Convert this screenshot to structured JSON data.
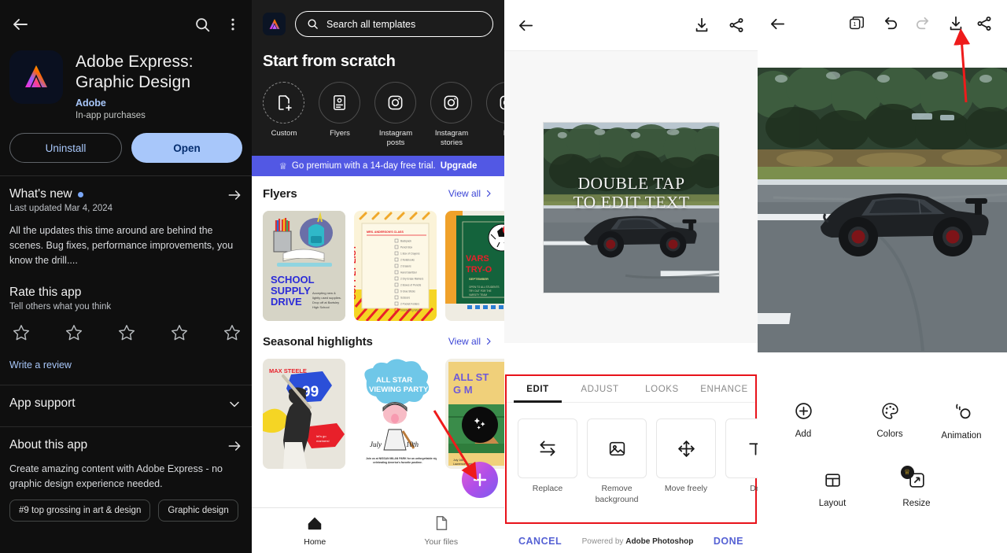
{
  "panel1": {
    "name": "google-play-store-app-page",
    "topbar": {
      "back_icon": "back-arrow-icon",
      "search_icon": "search-icon",
      "more_icon": "overflow-menu-icon"
    },
    "app": {
      "title": "Adobe Express: Graphic Design",
      "developer": "Adobe",
      "iap": "In-app purchases",
      "icon": "adobe-express-logo-icon"
    },
    "buttons": {
      "uninstall": "Uninstall",
      "open": "Open"
    },
    "whats_new": {
      "heading": "What's new",
      "subtitle": "Last updated Mar 4, 2024",
      "body": "All the updates this time around are behind the scenes. Bug fixes, performance improvements, you know the drill....",
      "arrow_icon": "arrow-right-icon"
    },
    "rate": {
      "heading": "Rate this app",
      "subtitle": "Tell others what you think",
      "stars": 5,
      "write_review": "Write a review"
    },
    "app_support": {
      "label": "App support",
      "chevron_icon": "chevron-down-icon"
    },
    "about": {
      "label": "About this app",
      "arrow_icon": "arrow-right-icon",
      "body": "Create amazing content with Adobe Express - no graphic design experience needed."
    },
    "chips": [
      "#9 top grossing in art & design",
      "Graphic design"
    ]
  },
  "panel2": {
    "name": "adobe-express-home",
    "logo_icon": "adobe-express-logo-icon",
    "search": {
      "placeholder": "Search all templates",
      "icon": "search-icon"
    },
    "scratch_heading": "Start from scratch",
    "scratch_items": [
      {
        "label": "Custom",
        "icon": "document-plus-icon"
      },
      {
        "label": "Flyers",
        "icon": "flyer-icon"
      },
      {
        "label": "Instagram posts",
        "icon": "instagram-icon"
      },
      {
        "label": "Instagram stories",
        "icon": "instagram-icon"
      },
      {
        "label": "Lo",
        "icon": "instagram-icon"
      }
    ],
    "premium_banner": {
      "crown_icon": "crown-icon",
      "text": "Go premium with a 14-day free trial.",
      "cta": "Upgrade"
    },
    "rows": [
      {
        "title": "Flyers",
        "view_all": "View all",
        "cards": [
          {
            "name": "school-supply-drive-flyer",
            "title": "SCHOOL SUPPLY DRIVE",
            "caption": "Accepting new & lightly used supplies. Drop off at Bartsley High School"
          },
          {
            "name": "first-grade-supply-list-flyer",
            "title": "FIRST GRADE SUPPLY LIST",
            "caption": "MRS. ANDERSON'S CLASS"
          },
          {
            "name": "varsity-tryouts-flyer",
            "title": "VARSITY TRY-OUTS",
            "caption": "SEPTEMBER"
          }
        ]
      },
      {
        "title": "Seasonal highlights",
        "view_all": "View all",
        "cards": [
          {
            "name": "max-steele-baseball-card",
            "title": "MAX STEELE",
            "caption": "99"
          },
          {
            "name": "all-star-viewing-party-flyer",
            "title": "ALL STAR VIEWING PARTY",
            "caption": "July 10th"
          },
          {
            "name": "all-star-game-flyer",
            "title": "ALL ST",
            "caption": ""
          }
        ]
      }
    ],
    "bottom_nav": [
      {
        "label": "Home",
        "icon": "home-icon",
        "active": true
      },
      {
        "label": "Your files",
        "icon": "files-icon",
        "active": false
      }
    ],
    "fab_black_icon": "sparkle-icon",
    "fab_plus_icon": "plus-icon"
  },
  "panel3": {
    "name": "photoshop-express-editor",
    "topbar": {
      "back_icon": "back-arrow-icon",
      "download_icon": "download-icon",
      "share_icon": "share-icon"
    },
    "canvas": {
      "overlay_text_line1": "DOUBLE TAP",
      "overlay_text_line2": "TO EDIT TEXT",
      "photo": "black-sports-car-on-highway"
    },
    "tabs": [
      {
        "label": "EDIT",
        "active": true
      },
      {
        "label": "ADJUST",
        "active": false
      },
      {
        "label": "LOOKS",
        "active": false
      },
      {
        "label": "ENHANCE",
        "active": false
      }
    ],
    "tools": [
      {
        "label": "Replace",
        "icon": "swap-arrows-icon"
      },
      {
        "label": "Remove background",
        "icon": "image-icon"
      },
      {
        "label": "Move freely",
        "icon": "move-icon"
      },
      {
        "label": "De",
        "icon": "text-icon"
      }
    ],
    "footer": {
      "cancel": "CANCEL",
      "powered_prefix": "Powered by ",
      "powered_brand": "Adobe Photoshop",
      "done": "DONE"
    }
  },
  "panel4": {
    "name": "adobe-express-project-editor",
    "topbar": {
      "back_icon": "back-arrow-icon",
      "pages_icon": "pages-stack-icon",
      "undo_icon": "undo-icon",
      "redo_icon": "redo-icon",
      "download_icon": "download-icon",
      "share_icon": "share-icon"
    },
    "canvas": {
      "photo": "black-sports-car-on-highway"
    },
    "grid": [
      {
        "label": "Add",
        "icon": "plus-circle-icon",
        "premium": false
      },
      {
        "label": "Colors",
        "icon": "palette-icon",
        "premium": false
      },
      {
        "label": "Animation",
        "icon": "animation-icon",
        "premium": false
      },
      {
        "label": "Layout",
        "icon": "layout-icon",
        "premium": false
      },
      {
        "label": "Resize",
        "icon": "resize-icon",
        "premium": true
      }
    ]
  },
  "annotations": {
    "arrow_color": "#ee1b1b",
    "box_color": "#e8121a",
    "items": [
      {
        "name": "arrow-to-fab-plus",
        "target": "panel2 plus fab"
      },
      {
        "name": "arrow-to-download-icon",
        "target": "panel4 download icon"
      },
      {
        "name": "highlight-box-edit-tools",
        "target": "panel3 edit tool strip"
      }
    ]
  },
  "colors": {
    "play_bg": "#0f0f0f",
    "play_accent": "#a8c7fa",
    "express_dark": "#1c1c1c",
    "premium_purple": "#5258e4",
    "express_link": "#3b45d6",
    "red_annotation": "#ee1b1b"
  }
}
